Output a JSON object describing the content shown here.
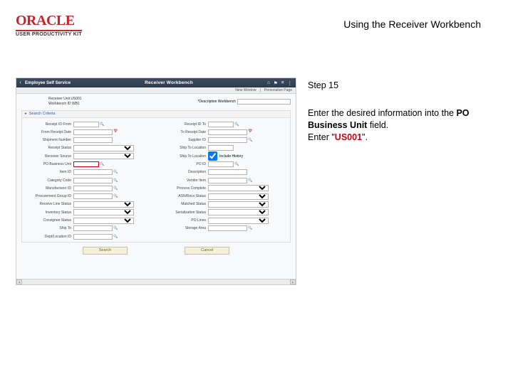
{
  "branding": {
    "oracle": "ORACLE",
    "upk": "USER PRODUCTIVITY KIT"
  },
  "doc_title": "Using the Receiver Workbench",
  "step_label": "Step 15",
  "instruction": {
    "pre": "Enter the desired information into the ",
    "bold": "PO Business Unit",
    "mid": " field.",
    "enter_pre": "Enter \"",
    "value": "US001",
    "enter_post": "\"."
  },
  "app": {
    "back": "‹",
    "ess": "Employee Self Service",
    "title": "Receiver Workbench",
    "icons": {
      "home": "⌂",
      "flag": "⚑",
      "menu": "≡",
      "dots": "⋮"
    },
    "subbar": {
      "newwin": "New Window",
      "personalize": "Personalize Page"
    },
    "info": {
      "l1": "Receiver Unit  US001",
      "l2": "Workbench ID  WB1"
    },
    "desc_label": "*Description Workbench",
    "section": "Search Criteria",
    "left_fields": [
      {
        "label": "Receipt ID From",
        "type": "text",
        "sz": "w-s",
        "lk": true
      },
      {
        "label": "From Receipt Date",
        "type": "text",
        "sz": "w-m",
        "cal": true
      },
      {
        "label": "Shipment Number",
        "type": "text",
        "sz": "w-m"
      },
      {
        "label": "Receipt Status",
        "type": "select",
        "sz": "w-l"
      },
      {
        "label": "Receiver Source",
        "type": "select",
        "sz": "w-l"
      },
      {
        "label": "PO Business Unit",
        "type": "text",
        "sz": "w-s",
        "lk": true,
        "hl": true
      },
      {
        "label": "Item ID",
        "type": "text",
        "sz": "w-m",
        "lk": true
      },
      {
        "label": "Category Code",
        "type": "text",
        "sz": "w-m",
        "lk": true
      },
      {
        "label": "Manufacturer ID",
        "type": "text",
        "sz": "w-m",
        "lk": true
      },
      {
        "label": "Procurement Group ID",
        "type": "text",
        "sz": "w-m",
        "lk": true
      },
      {
        "label": "Receive Line Status",
        "type": "select",
        "sz": "w-l"
      },
      {
        "label": "Inventory Status",
        "type": "select",
        "sz": "w-l"
      },
      {
        "label": "Consignee Status",
        "type": "select",
        "sz": "w-l"
      },
      {
        "label": "Ship To",
        "type": "text",
        "sz": "w-m",
        "lk": true
      },
      {
        "label": "Dept/Location ID",
        "type": "text",
        "sz": "w-m",
        "lk": true
      }
    ],
    "right_fields": [
      {
        "label": "Receipt ID To",
        "type": "text",
        "sz": "w-s",
        "lk": true
      },
      {
        "label": "To Receipt Date",
        "type": "text",
        "sz": "w-m",
        "cal": true
      },
      {
        "label": "Supplier ID",
        "type": "text",
        "sz": "w-m",
        "lk": true
      },
      {
        "label": "Ship To Location",
        "type": "text",
        "sz": "w-s"
      },
      {
        "label": "Ship To Location",
        "type": "checkbox",
        "chklabel": "Include History"
      },
      {
        "label": "PO ID",
        "type": "text",
        "sz": "w-s",
        "lk": true
      },
      {
        "label": "Description",
        "type": "text",
        "sz": "w-m"
      },
      {
        "label": "Vendor Item",
        "type": "text",
        "sz": "w-m",
        "lk": true
      },
      {
        "label": "Process Complete",
        "type": "select",
        "sz": "w-l"
      },
      {
        "label": "ASN/Recv Status",
        "type": "select",
        "sz": "w-l"
      },
      {
        "label": "Matched Status",
        "type": "select",
        "sz": "w-l"
      },
      {
        "label": "Serialization Status",
        "type": "select",
        "sz": "w-l"
      },
      {
        "label": "PO Lines",
        "type": "select",
        "sz": "w-l"
      },
      {
        "label": "Storage Area",
        "type": "text",
        "sz": "w-m",
        "lk": true
      }
    ],
    "btn_search": "Search",
    "btn_cancel": "Cancel"
  }
}
